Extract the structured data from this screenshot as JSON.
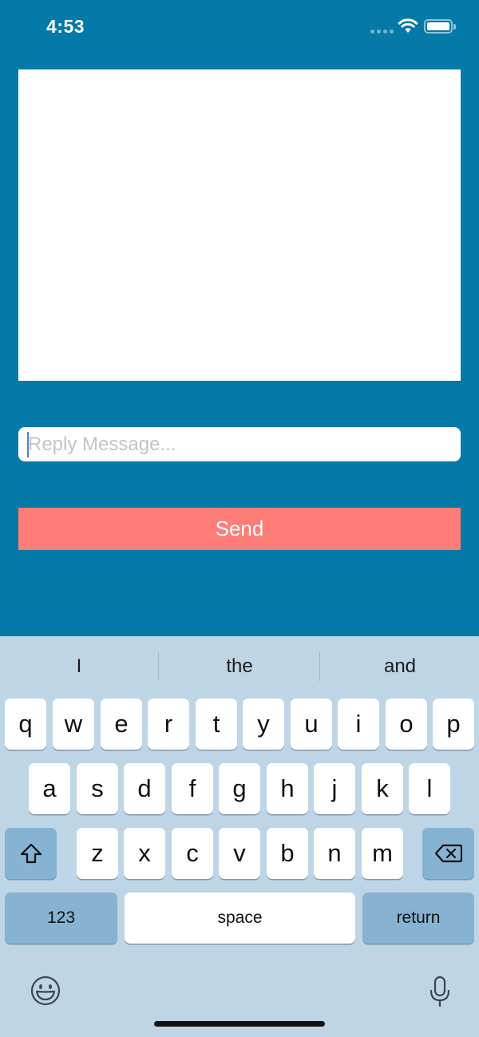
{
  "status_bar": {
    "time": "4:53",
    "icons": [
      "signal-dots-icon",
      "wifi-icon",
      "battery-icon"
    ]
  },
  "message_area": {
    "content": ""
  },
  "reply": {
    "placeholder": "Reply Message...",
    "value": ""
  },
  "send_button": {
    "label": "Send",
    "color": "#ff7d78"
  },
  "background_color": "#0579a8",
  "keyboard": {
    "suggestions": [
      "I",
      "the",
      "and"
    ],
    "row1": [
      "q",
      "w",
      "e",
      "r",
      "t",
      "y",
      "u",
      "i",
      "o",
      "p"
    ],
    "row2": [
      "a",
      "s",
      "d",
      "f",
      "g",
      "h",
      "j",
      "k",
      "l"
    ],
    "row3": [
      "z",
      "x",
      "c",
      "v",
      "b",
      "n",
      "m"
    ],
    "numbers_label": "123",
    "space_label": "space",
    "return_label": "return",
    "icons": [
      "shift-icon",
      "backspace-icon",
      "emoji-icon",
      "microphone-icon"
    ]
  }
}
